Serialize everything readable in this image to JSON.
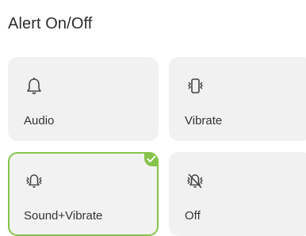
{
  "title": "Alert On/Off",
  "options": [
    {
      "label": "Audio",
      "icon": "bell-icon"
    },
    {
      "label": "Vibrate",
      "icon": "vibrate-phone-icon"
    },
    {
      "label": "Sound+Vibrate",
      "icon": "bell-vibrate-icon",
      "selected": true
    },
    {
      "label": "Off",
      "icon": "bell-off-icon"
    }
  ],
  "colors": {
    "card_bg": "#f1f1f2",
    "selected_border": "#86c34a",
    "text": "#333333"
  }
}
